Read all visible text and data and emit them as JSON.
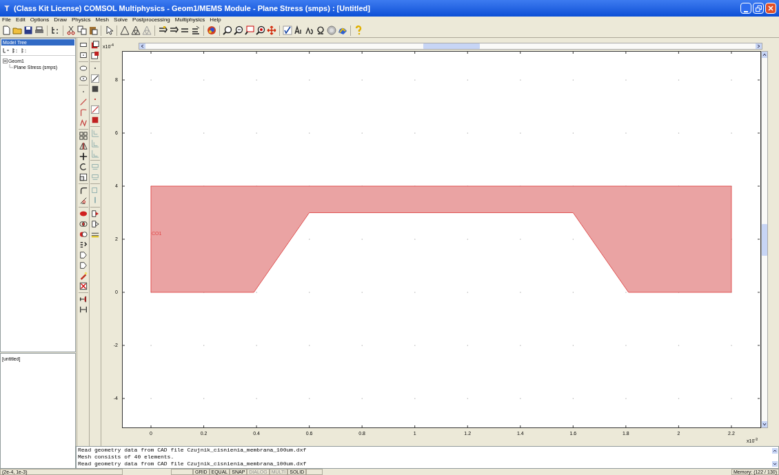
{
  "window": {
    "title": "(Class Kit License) COMSOL Multiphysics - Geom1/MEMS Module - Plane Stress (smps) : [Untitled]"
  },
  "menu": [
    "File",
    "Edit",
    "Options",
    "Draw",
    "Physics",
    "Mesh",
    "Solve",
    "Postprocessing",
    "Multiphysics",
    "Help"
  ],
  "model_tree": {
    "title": "Model Tree",
    "items": [
      {
        "label": "Geom1",
        "expanded": true,
        "children": [
          {
            "label": "Plane Stress (smps)"
          }
        ]
      }
    ]
  },
  "properties_panel": {
    "title": "[untitled]"
  },
  "canvas": {
    "y_exponent": "x10$^{-4}$",
    "x_exponent": "x10$^{-3}$",
    "x_tick_labels": [
      "0",
      "0.2",
      "0.4",
      "0.6",
      "0.8",
      "1",
      "1.2",
      "1.4",
      "1.6",
      "1.8",
      "2",
      "2.2"
    ],
    "y_tick_labels": [
      "8",
      "6",
      "4",
      "2",
      "0",
      "-2",
      "-4"
    ],
    "object_label": "CO1"
  },
  "log": [
    "Read geometry data from CAD file Czujnik_cisnienia_membrana_100um.dxf",
    "Mesh consists of 40 elements.",
    "Read geometry data from CAD file Czujnik_cisnienia_membrana_100um.dxf"
  ],
  "status_bar": {
    "coordinates": "(2e-4, 1e-3)",
    "toggles": [
      {
        "label": "GRID",
        "disabled": false
      },
      {
        "label": "EQUAL",
        "disabled": false
      },
      {
        "label": "SNAP",
        "disabled": false
      },
      {
        "label": "DIALOG",
        "disabled": true
      },
      {
        "label": "MULTI",
        "disabled": true
      },
      {
        "label": "SOLID",
        "disabled": false
      }
    ],
    "memory": "Memory: (122 / 130)"
  }
}
